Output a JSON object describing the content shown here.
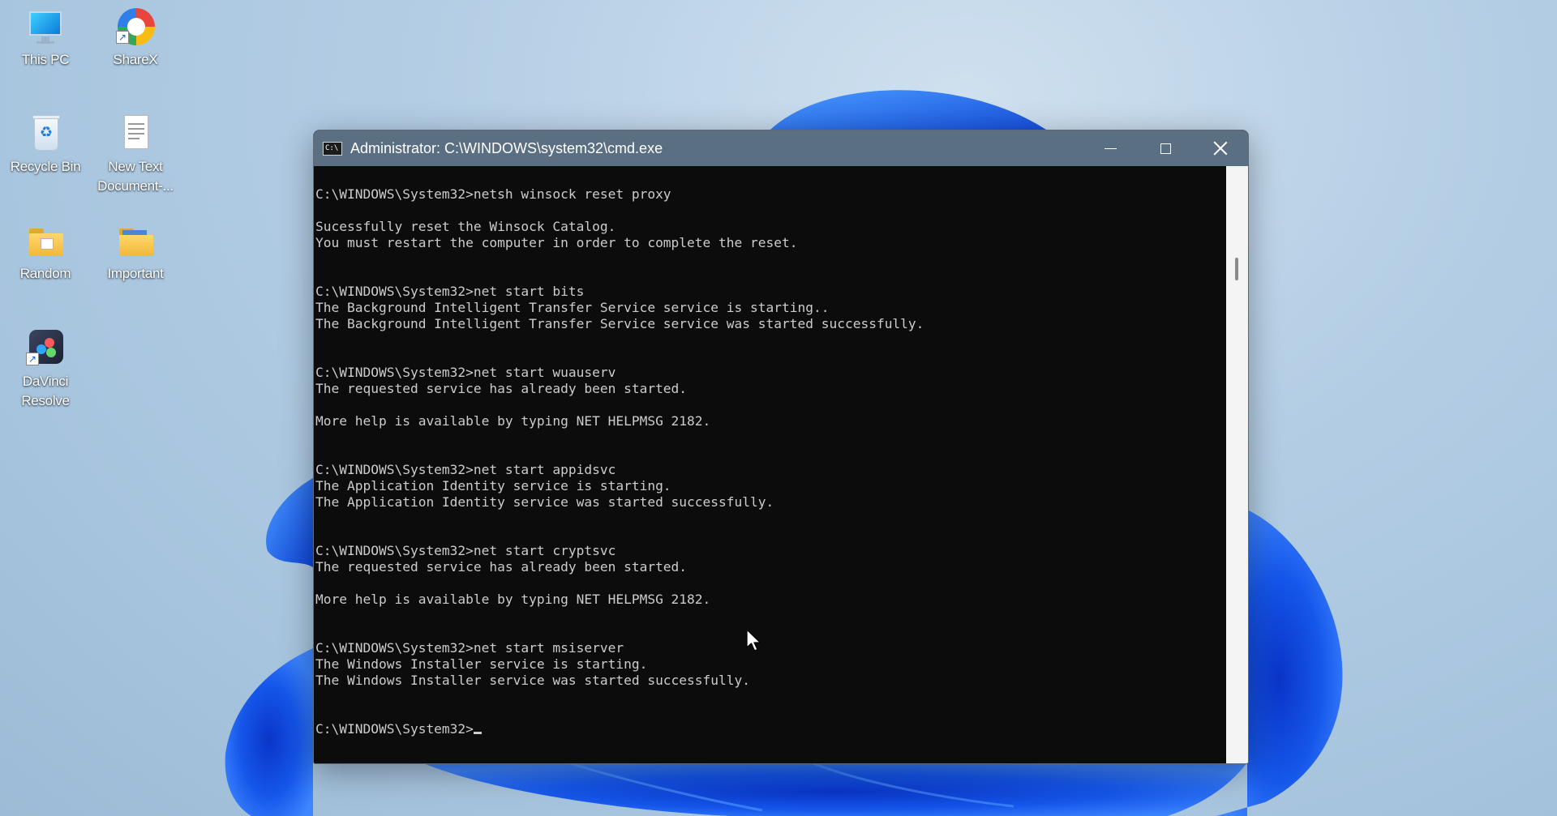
{
  "desktop": {
    "icons": [
      {
        "label": "This PC",
        "icon": "monitor-icon"
      },
      {
        "label": "ShareX",
        "icon": "sharex-icon"
      },
      {
        "label": "Recycle Bin",
        "icon": "recycle-bin-icon"
      },
      {
        "label": "New Text Document-...",
        "label_line1": "New Text",
        "label_line2": "Document-...",
        "icon": "text-document-icon"
      },
      {
        "label": "Random",
        "icon": "folder-icon"
      },
      {
        "label": "Important",
        "icon": "folder-icon"
      },
      {
        "label": "DaVinci Resolve",
        "label_line1": "DaVinci",
        "label_line2": "Resolve",
        "icon": "davinci-resolve-icon"
      }
    ]
  },
  "window": {
    "title": "Administrator: C:\\WINDOWS\\system32\\cmd.exe",
    "icon_text": "C:\\",
    "controls": [
      "minimize",
      "maximize",
      "close"
    ]
  },
  "console": {
    "lines": [
      "C:\\WINDOWS\\System32>netsh winsock reset proxy",
      "",
      "Sucessfully reset the Winsock Catalog.",
      "You must restart the computer in order to complete the reset.",
      "",
      "",
      "C:\\WINDOWS\\System32>net start bits",
      "The Background Intelligent Transfer Service service is starting..",
      "The Background Intelligent Transfer Service service was started successfully.",
      "",
      "",
      "C:\\WINDOWS\\System32>net start wuauserv",
      "The requested service has already been started.",
      "",
      "More help is available by typing NET HELPMSG 2182.",
      "",
      "",
      "C:\\WINDOWS\\System32>net start appidsvc",
      "The Application Identity service is starting.",
      "The Application Identity service was started successfully.",
      "",
      "",
      "C:\\WINDOWS\\System32>net start cryptsvc",
      "The requested service has already been started.",
      "",
      "More help is available by typing NET HELPMSG 2182.",
      "",
      "",
      "C:\\WINDOWS\\System32>net start msiserver",
      "The Windows Installer service is starting.",
      "The Windows Installer service was started successfully.",
      "",
      ""
    ],
    "prompt": "C:\\WINDOWS\\System32>"
  },
  "colors": {
    "titlebar": "#5b6f83",
    "console_bg": "#0c0c0c",
    "console_fg": "#cccccc",
    "wallpaper_bloom": "#1a5ff0"
  }
}
